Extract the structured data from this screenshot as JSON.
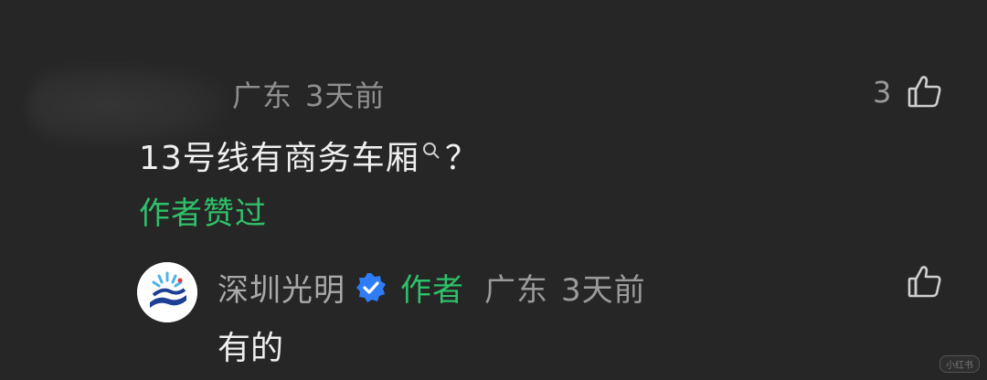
{
  "comment": {
    "location": "广东",
    "time": "3天前",
    "like_count": "3",
    "text_before": "13号线有商务车厢",
    "text_after": "？",
    "liked_by_author": "作者赞过"
  },
  "reply": {
    "username": "深圳光明",
    "author_tag": "作者",
    "location": "广东",
    "time": "3天前",
    "text": "有的"
  },
  "watermark": "小红书",
  "colors": {
    "background": "#262626",
    "accent_green": "#2fc06a",
    "verified_blue": "#2f7df6",
    "meta_gray": "#8f8f8f"
  },
  "icons": [
    "thumbs-up-icon",
    "search-icon",
    "verified-badge-icon"
  ]
}
